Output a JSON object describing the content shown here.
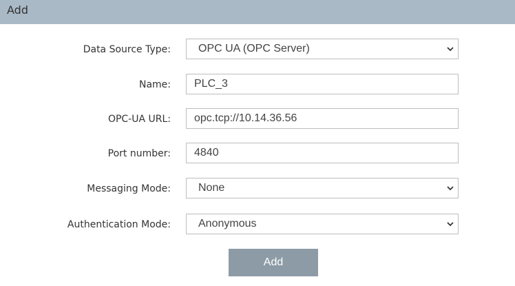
{
  "dialog": {
    "title": "Add"
  },
  "form": {
    "data_source_type": {
      "label": "Data Source Type:",
      "value": "OPC UA (OPC Server)"
    },
    "name": {
      "label": "Name:",
      "value": "PLC_3"
    },
    "opcua_url": {
      "label": "OPC-UA URL:",
      "value": "opc.tcp://10.14.36.56"
    },
    "port_number": {
      "label": "Port number:",
      "value": "4840"
    },
    "messaging_mode": {
      "label": "Messaging Mode:",
      "value": "None"
    },
    "authentication_mode": {
      "label": "Authentication Mode:",
      "value": "Anonymous"
    }
  },
  "actions": {
    "add_label": "Add"
  },
  "icons": {
    "dropdown": "chevron-down-icon"
  },
  "colors": {
    "titlebar_bg": "#a9b9c6",
    "button_bg": "#8c9ba6"
  }
}
